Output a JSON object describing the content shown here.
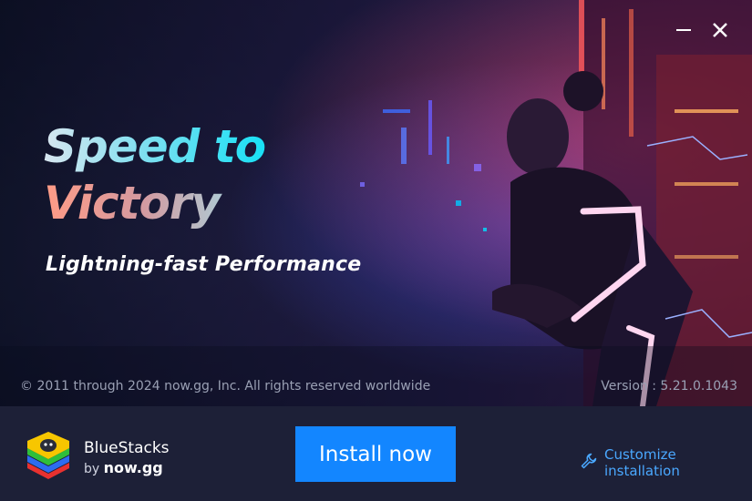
{
  "hero": {
    "headline_line1": "Speed to",
    "headline_line2": "Victory",
    "subtitle": "Lightning-fast Performance",
    "copyright": "© 2011 through 2024 now.gg, Inc. All rights reserved worldwide",
    "version": "Version : 5.21.0.1043"
  },
  "window_controls": {
    "minimize_icon": "minimize-icon",
    "close_icon": "close-icon"
  },
  "footer": {
    "brand_name": "BlueStacks",
    "brand_by": "by",
    "brand_company": "now.gg",
    "install_label": "Install now",
    "customize_label": "Customize installation",
    "customize_icon": "wrench-icon"
  },
  "colors": {
    "accent": "#1386ff",
    "link": "#4aa8ff",
    "footer_bg": "#1d2037"
  }
}
